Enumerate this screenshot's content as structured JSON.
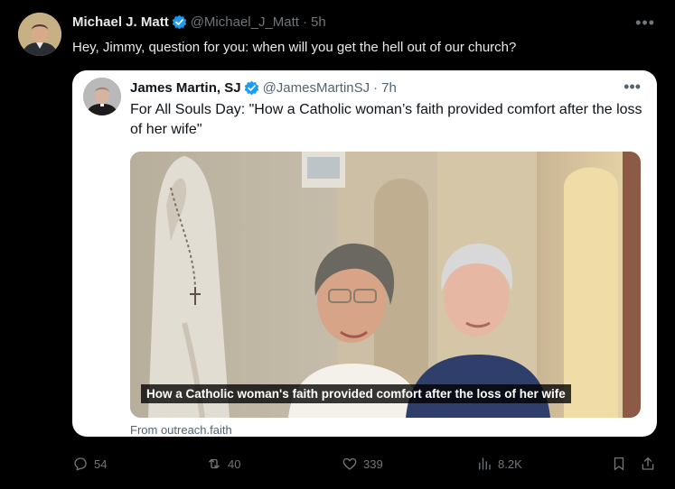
{
  "tweet": {
    "author_name": "Michael J. Matt",
    "author_handle": "@Michael_J_Matt",
    "separator": "·",
    "time": "5h",
    "text": "Hey, Jimmy, question for you: when will you get the hell out of our church?",
    "more_icon": "more-icon"
  },
  "quote": {
    "author_name": "James Martin, SJ",
    "author_handle": "@JamesMartinSJ",
    "separator": "·",
    "time": "7h",
    "text": "For All Souls Day: \"How a Catholic woman’s faith provided comfort after the loss of her wife\"",
    "media_caption": "How a Catholic woman's faith provided comfort after the loss of her wife",
    "source": "From outreach.faith"
  },
  "actions": {
    "replies": "54",
    "reposts": "40",
    "likes": "339",
    "views": "8.2K"
  },
  "colors": {
    "verified_blue": "#1d9bf0",
    "muted_text": "#71767b",
    "background": "#000000"
  }
}
